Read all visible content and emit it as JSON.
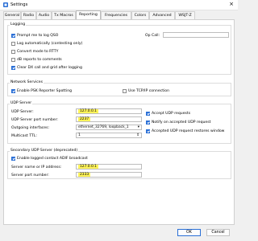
{
  "window": {
    "title": "Settings"
  },
  "tabs": [
    "General",
    "Radio",
    "Audio",
    "Tx Macros",
    "Reporting",
    "Frequencies",
    "Colors",
    "Advanced",
    "WSJT-Z"
  ],
  "logging": {
    "title": "Logging",
    "prompt_qso": "Prompt me to log QSO",
    "op_call": "Op Call:",
    "log_auto": "Log automatically (contesting only)",
    "convert_rtty": "Convert mode to RTTY",
    "db_reports": "dB reports to comments",
    "clear_dx": "Clear DX call and grid after logging"
  },
  "network": {
    "title": "Network Services",
    "psk": "Enable PSK Reporter Spotting",
    "tcp": "Use TCP/IP connection"
  },
  "udp": {
    "title": "UDP Server",
    "server_label": "UDP Server:",
    "server_value": "127.0.0.1",
    "port_label": "UDP Server port number:",
    "port_value": "2237",
    "interfaces_label": "Outgoing interfaces:",
    "interfaces_value": "ethernet_32769, loopback_1",
    "ttl_label": "Multicast TTL:",
    "ttl_value": "1",
    "accept": "Accept UDP requests",
    "notify": "Notify on accepted UDP request",
    "restore": "Accepted UDP request restores window"
  },
  "secondary": {
    "title": "Secondary UDP Server (deprecated)",
    "adif": "Enable logged contact ADIF broadcast",
    "name_label": "Server name or IP address:",
    "name_value": "127.0.0.1",
    "port_label": "Server port number:",
    "port_value": "2333"
  },
  "footer": {
    "ok": "OK",
    "cancel": "Cancel"
  },
  "colors": {
    "accent": "#2a6fd6",
    "highlight": "#fff45a"
  },
  "icons": {
    "app": "wsjt-icon",
    "close": "close-icon",
    "checkbox": "checkmark"
  }
}
